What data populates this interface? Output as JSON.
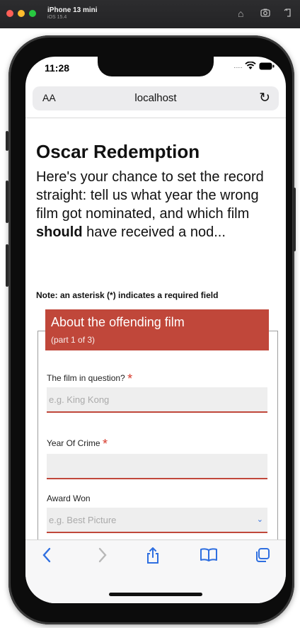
{
  "simulator": {
    "device_name": "iPhone 13 mini",
    "os_version": "iOS 15.4"
  },
  "status_bar": {
    "time": "11:28",
    "signal_text": "....."
  },
  "browser": {
    "text_size_label": "AA",
    "url": "localhost"
  },
  "page": {
    "title": "Oscar Redemption",
    "intro_before": "Here's your chance to set the record straight: tell us what year the wrong film got nominated, and which film ",
    "intro_bold": "should",
    "intro_after": " have received a nod...",
    "note": "Note: an asterisk (*) indicates a required field"
  },
  "form": {
    "section_title": "About the offending film",
    "section_subtitle": "(part 1 of 3)",
    "required_marker": "*",
    "fields": [
      {
        "label": "The film in question?",
        "placeholder": "e.g. King Kong",
        "value": ""
      },
      {
        "label": "Year Of Crime",
        "placeholder": "",
        "value": ""
      },
      {
        "label": "Award Won",
        "placeholder": "e.g. Best Picture",
        "value": ""
      }
    ]
  },
  "colors": {
    "accent_red": "#c0473a",
    "ios_blue": "#2f6fe0"
  }
}
